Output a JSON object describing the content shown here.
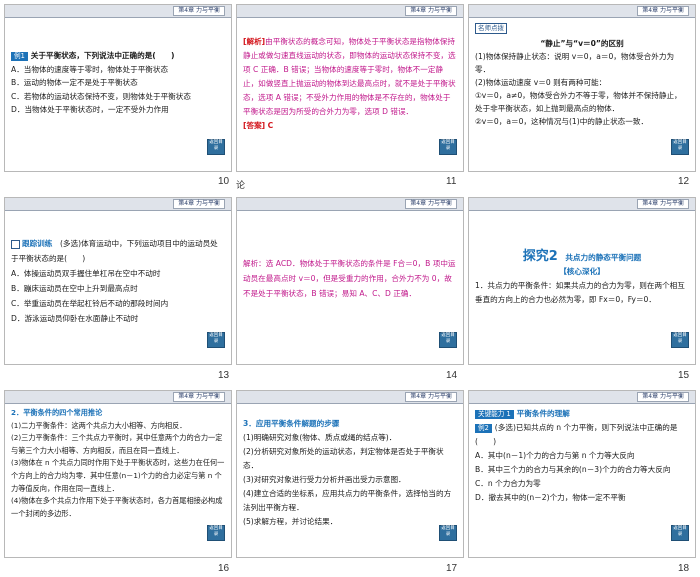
{
  "chapter_header": "第4章 力与平衡",
  "nav_button": "返回目录",
  "slides": [
    {
      "number": "10",
      "tag": "例1",
      "question": "关于平衡状态，下列说法中正确的是(　　)",
      "options": [
        "A．当物体的速度等于零时，物体处于平衡状态",
        "B．运动的物体一定不是处于平衡状态",
        "C．若物体的运动状态保持不变，则物体处于平衡状态",
        "D．当物体处于平衡状态时，一定不受外力作用"
      ]
    },
    {
      "number": "11",
      "analysis_label": "[解析]",
      "analysis": "由平衡状态的概念可知，物体处于平衡状态是指物体保持静止或做匀速直线运动的状态，即物体的运动状态保持不变，选项 C 正确．B 错误；当物体的速度等于零时，物体不一定静止，如做竖直上抛运动的物体到达最高点时，就不是处于平衡状态，选项 A 错误；不受外力作用的物体是不存在的，物体处于平衡状态是因为所受的合外力为零，选项 D 错误．",
      "answer_label": "[答案]",
      "answer": "C"
    },
    {
      "number": "12",
      "box_label": "名师点拨",
      "heading": "“静止”与“v＝0”的区别",
      "lines": [
        "(1)物体保持静止状态：说明 v＝0，a＝0，物体受合外力为零．",
        "(2)物体运动速度 v＝0 则有两种可能：",
        "①v＝0，a≠0，物体受合外力不等于零，物体并不保持静止，处于非平衡状态，如上抛到最高点的物体．",
        "②v＝0，a＝0，这种情况与(1)中的静止状态一致．"
      ]
    },
    {
      "number": "13",
      "tag": "跟踪训练",
      "question": "(多选)体育运动中，下列运动项目中的运动员处于平衡状态的是(　　)",
      "options": [
        "A．体操运动员双手握住单杠吊在空中不动时",
        "B．蹦床运动员在空中上升到最高点时",
        "C．举重运动员在举起杠铃后不动的那段时间内",
        "D．游泳运动员仰卧在水面静止不动时"
      ]
    },
    {
      "number": "14",
      "analysis": "解析：选 ACD．物体处于平衡状态的条件是 F合＝0，B 项中运动员在最高点时 v＝0，但是受重力的作用，合外力不为 0，故不是处于平衡状态，B 错误；易知 A、C、D 正确．"
    },
    {
      "number": "15",
      "topic_label": "探究2",
      "topic_title": "共点力的静态平衡问题",
      "core_label": "【核心深化】",
      "text": "1．共点力的平衡条件：如果共点力的合力为零，则在两个相互垂直的方向上的合力也必然为零，即 Fx＝0，Fy＝0．"
    },
    {
      "number": "16",
      "heading": "2．平衡条件的四个常用推论",
      "lines": [
        "(1)二力平衡条件：这两个共点力大小相等、方向相反．",
        "(2)三力平衡条件：三个共点力平衡时，其中任意两个力的合力一定与第三个力大小相等、方向相反，而且在同一直线上．",
        "(3)物体在 n 个共点力同时作用下处于平衡状态时，这些力在任何一个方向上的合力均为零．其中任意(n－1)个力的合力必定与第 n 个力等值反向，作用在同一直线上．",
        "(4)物体在多个共点力作用下处于平衡状态时，各力首尾相接必构成一个封闭的多边形．"
      ]
    },
    {
      "number": "17",
      "heading": "3．应用平衡条件解题的步骤",
      "lines": [
        "(1)明确研究对象(物体、质点或绳的结点等)．",
        "(2)分析研究对象所处的运动状态，判定物体是否处于平衡状态．",
        "(3)对研究对象进行受力分析并画出受力示意图．",
        "(4)建立合适的坐标系，应用共点力的平衡条件，选择恰当的方法列出平衡方程．",
        "(5)求解方程，并讨论结果．"
      ]
    },
    {
      "number": "18",
      "tag": "关键能力 1",
      "tag_title": "平衡条件的理解",
      "example_tag": "例2",
      "question": "(多选)已知共点的 n 个力平衡，则下列说法中正确的是(　　)",
      "options": [
        "A．其中(n－1)个力的合力与第 n 个力等大反向",
        "B．其中三个力的合力与其余的(n－3)个力的合力等大反向",
        "C．n 个力合力为零",
        "D．撤去其中的(n－2)个力，物体一定不平衡"
      ]
    }
  ],
  "stray_text": "论"
}
